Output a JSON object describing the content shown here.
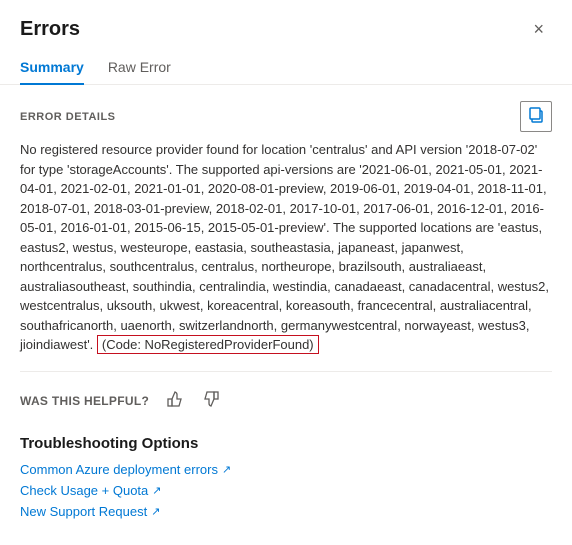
{
  "dialog": {
    "title": "Errors",
    "close_label": "×"
  },
  "tabs": [
    {
      "id": "summary",
      "label": "Summary",
      "active": true
    },
    {
      "id": "raw-error",
      "label": "Raw Error",
      "active": false
    }
  ],
  "error_details": {
    "section_label": "ERROR DETAILS",
    "copy_tooltip": "Copy",
    "message_prefix": "No registered resource provider found for location 'centralus' and API version '2018-07-02' for type 'storageAccounts'. The supported api-versions are '2021-06-01, 2021-05-01, 2021-04-01, 2021-02-01, 2021-01-01, 2020-08-01-preview, 2019-06-01, 2019-04-01, 2018-11-01, 2018-07-01, 2018-03-01-preview, 2018-02-01, 2017-10-01, 2017-06-01, 2016-12-01, 2016-05-01, 2016-01-01, 2015-06-15, 2015-05-01-preview'. The supported locations are 'eastus, eastus2, westus, westeurope, eastasia, southeastasia, japaneast, japanwest, northcentralus, southcentralus, centralus, northeurope, brazilsouth, australiaeast, australiasoutheast, southindia, centralindia, westindia, canadaeast, canadacentral, westus2, westcentralus, uksouth, ukwest, koreacentral, koreasouth, francecentral, australiacentral, southafricanorth, uaenorth, switzerlandnorth, germanywestcentral, norwayeast, westus3, jioindiawest'.",
    "error_code": "(Code: NoRegisteredProviderFound)",
    "was_helpful_label": "WAS THIS HELPFUL?"
  },
  "troubleshooting": {
    "title": "Troubleshooting Options",
    "links": [
      {
        "label": "Common Azure deployment errors",
        "id": "common-errors-link"
      },
      {
        "label": "Check Usage + Quota",
        "id": "check-quota-link"
      },
      {
        "label": "New Support Request",
        "id": "support-request-link"
      }
    ]
  }
}
